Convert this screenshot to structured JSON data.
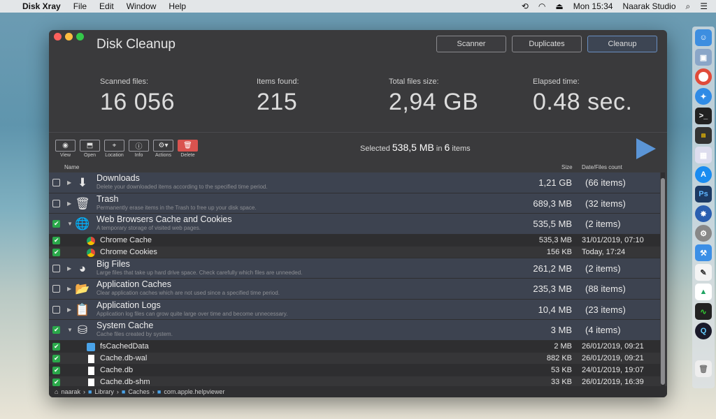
{
  "menubar": {
    "apple": "",
    "app": "Disk Xray",
    "menus": [
      "File",
      "Edit",
      "Window",
      "Help"
    ],
    "clock": "Mon 15:34",
    "user": "Naarak Studio"
  },
  "window": {
    "title": "Disk Cleanup",
    "tabs": [
      {
        "label": "Scanner"
      },
      {
        "label": "Duplicates"
      },
      {
        "label": "Cleanup"
      }
    ]
  },
  "stats": {
    "scanned": {
      "label": "Scanned files:",
      "value": "16 056"
    },
    "items": {
      "label": "Items found:",
      "value": "215"
    },
    "size": {
      "label": "Total files size:",
      "value": "2,94 GB"
    },
    "elapsed": {
      "label": "Elapsed time:",
      "value": "0.48 sec."
    }
  },
  "toolbar": {
    "tools": [
      {
        "label": "View"
      },
      {
        "label": "Open"
      },
      {
        "label": "Location"
      },
      {
        "label": "Info"
      },
      {
        "label": "Actions"
      },
      {
        "label": "Delete"
      }
    ],
    "selected_prefix": "Selected",
    "selected_size": "538,5 MB",
    "selected_mid": "in",
    "selected_count": "6",
    "selected_suffix": "items"
  },
  "table": {
    "headers": {
      "name": "Name",
      "size": "Size",
      "date": "Date/Files count"
    },
    "categories": [
      {
        "name": "Downloads",
        "desc": "Delete your downloaded items according to the specified time period.",
        "size": "1,21 GB",
        "count": "(66 items)",
        "checked": false,
        "expanded": false,
        "icon": "download-icon"
      },
      {
        "name": "Trash",
        "desc": "Permanently erase items in the Trash to free up your disk space.",
        "size": "689,3 MB",
        "count": "(32 items)",
        "checked": false,
        "expanded": false,
        "icon": "trash-icon"
      },
      {
        "name": "Web Browsers Cache and Cookies",
        "desc": "A temporary storage of visited web pages.",
        "size": "535,5 MB",
        "count": "(2 items)",
        "checked": true,
        "expanded": true,
        "icon": "globe-icon",
        "children": [
          {
            "name": "Chrome Cache",
            "size": "535,3 MB",
            "date": "31/01/2019, 07:10",
            "checked": true,
            "icon": "chrome-icon"
          },
          {
            "name": "Chrome Cookies",
            "size": "156 KB",
            "date": "Today, 17:24",
            "checked": true,
            "icon": "chrome-icon"
          }
        ]
      },
      {
        "name": "Big Files",
        "desc": "Large files that take up hard drive space. Check carefully which files are unneeded.",
        "size": "261,2 MB",
        "count": "(2 items)",
        "checked": false,
        "expanded": false,
        "icon": "pie-chart-icon"
      },
      {
        "name": "Application Caches",
        "desc": "Clear application caches which are not used since a specified time period.",
        "size": "235,3 MB",
        "count": "(88 items)",
        "checked": false,
        "expanded": false,
        "icon": "folder-icon"
      },
      {
        "name": "Application Logs",
        "desc": "Application log files can grow quite large over time and become unnecessary.",
        "size": "10,4 MB",
        "count": "(23 items)",
        "checked": false,
        "expanded": false,
        "icon": "log-icon"
      },
      {
        "name": "System Cache",
        "desc": "Cache files created by system.",
        "size": "3 MB",
        "count": "(4 items)",
        "checked": true,
        "expanded": true,
        "icon": "system-cache-icon",
        "children": [
          {
            "name": "fsCachedData",
            "size": "2 MB",
            "date": "26/01/2019, 09:21",
            "checked": true,
            "icon": "folder-icon"
          },
          {
            "name": "Cache.db-wal",
            "size": "882 KB",
            "date": "26/01/2019, 09:21",
            "checked": true,
            "icon": "file-icon"
          },
          {
            "name": "Cache.db",
            "size": "53 KB",
            "date": "24/01/2019, 19:07",
            "checked": true,
            "icon": "file-icon"
          },
          {
            "name": "Cache.db-shm",
            "size": "33 KB",
            "date": "26/01/2019, 16:39",
            "checked": true,
            "icon": "file-icon"
          }
        ]
      }
    ]
  },
  "path": [
    "naarak",
    "Library",
    "Caches",
    "com.apple.helpviewer"
  ]
}
